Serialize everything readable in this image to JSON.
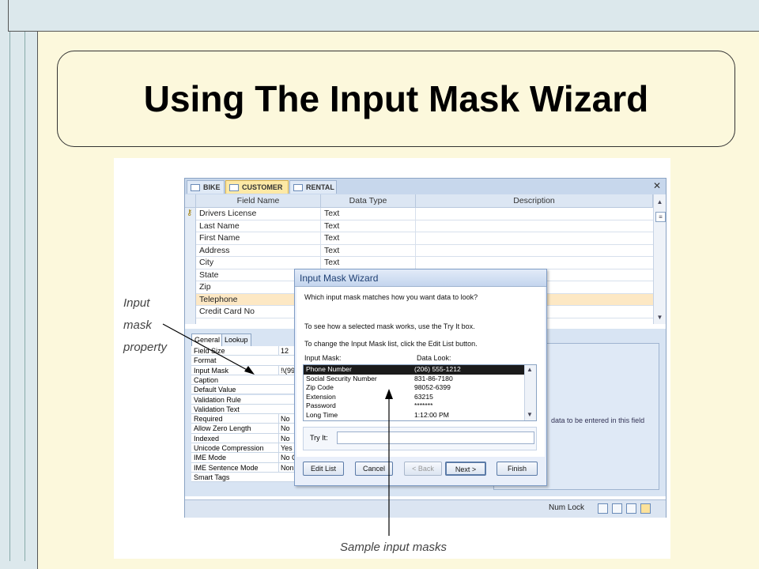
{
  "slide": {
    "title": "Using The Input Mask Wizard"
  },
  "tabs": [
    "BIKE",
    "CUSTOMER",
    "RENTAL"
  ],
  "grid": {
    "headers": [
      "Field Name",
      "Data Type",
      "Description"
    ],
    "rows": [
      {
        "name": "Drivers License",
        "type": "Text"
      },
      {
        "name": "Last Name",
        "type": "Text"
      },
      {
        "name": "First Name",
        "type": "Text"
      },
      {
        "name": "Address",
        "type": "Text"
      },
      {
        "name": "City",
        "type": "Text"
      },
      {
        "name": "State",
        "type": ""
      },
      {
        "name": "Zip",
        "type": ""
      },
      {
        "name": "Telephone",
        "type": ""
      },
      {
        "name": "Credit Card No",
        "type": ""
      }
    ]
  },
  "prop_tabs": [
    "General",
    "Lookup"
  ],
  "properties": [
    {
      "label": "Field Size",
      "value": "12"
    },
    {
      "label": "Format",
      "value": ""
    },
    {
      "label": "Input Mask",
      "value": "!\\(99"
    },
    {
      "label": "Caption",
      "value": ""
    },
    {
      "label": "Default Value",
      "value": ""
    },
    {
      "label": "Validation Rule",
      "value": ""
    },
    {
      "label": "Validation Text",
      "value": ""
    },
    {
      "label": "Required",
      "value": "No"
    },
    {
      "label": "Allow Zero Length",
      "value": "No"
    },
    {
      "label": "Indexed",
      "value": "No"
    },
    {
      "label": "Unicode Compression",
      "value": "Yes"
    },
    {
      "label": "IME Mode",
      "value": "No C"
    },
    {
      "label": "IME Sentence Mode",
      "value": "Non"
    },
    {
      "label": "Smart Tags",
      "value": ""
    }
  ],
  "desc_hint": "data to be entered in this field",
  "status": {
    "num_lock": "Num Lock"
  },
  "dialog": {
    "title": "Input Mask Wizard",
    "question": "Which input mask matches how you want data to look?",
    "hint1": "To see how a selected mask works, use the Try It box.",
    "hint2": "To change the Input Mask list, click the Edit List button.",
    "col_mask": "Input Mask:",
    "col_look": "Data Look:",
    "items": [
      {
        "mask": "Phone Number",
        "look": "(206) 555-1212"
      },
      {
        "mask": "Social Security Number",
        "look": "831-86-7180"
      },
      {
        "mask": "Zip Code",
        "look": "98052-6399"
      },
      {
        "mask": "Extension",
        "look": "63215"
      },
      {
        "mask": "Password",
        "look": "*******"
      },
      {
        "mask": "Long Time",
        "look": "1:12:00 PM"
      }
    ],
    "try_label": "Try It:",
    "buttons": {
      "edit": "Edit List",
      "cancel": "Cancel",
      "back": "< Back",
      "next": "Next >",
      "finish": "Finish"
    }
  },
  "captions": {
    "line1": "Input",
    "line2": "mask",
    "line3": "property",
    "sample": "Sample input masks"
  }
}
